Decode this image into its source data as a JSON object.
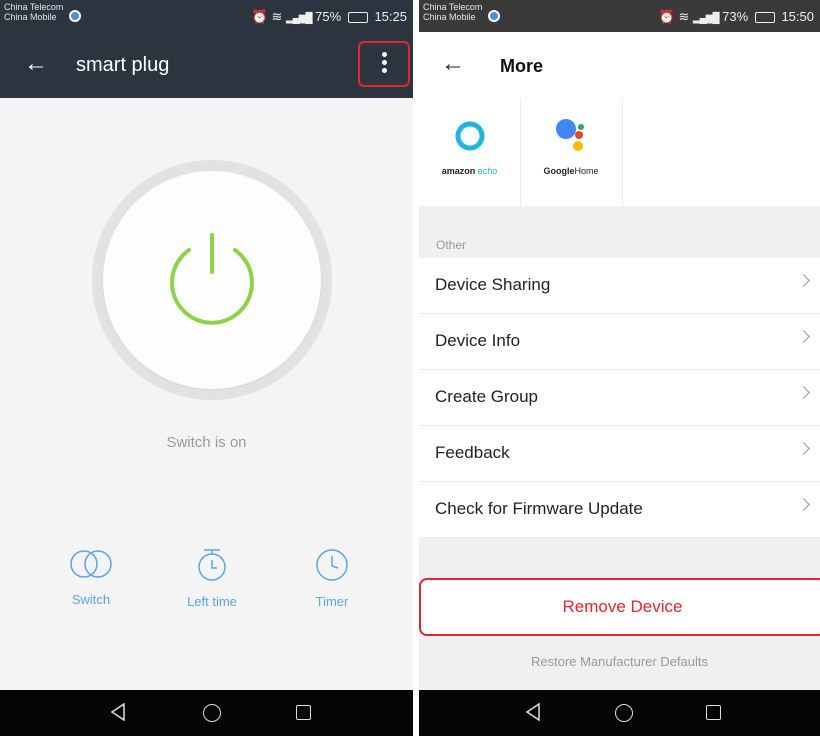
{
  "left": {
    "status": {
      "carrier1": "China Telecom",
      "carrier2": "China Mobile",
      "battery": "75%",
      "time": "15:25"
    },
    "appbar": {
      "title": "smart plug"
    },
    "switch_status": "Switch is on",
    "controls": [
      {
        "label": "Switch",
        "icon": "toggle-icon"
      },
      {
        "label": "Left time",
        "icon": "stopwatch-icon"
      },
      {
        "label": "Timer",
        "icon": "clock-icon"
      }
    ],
    "colors": {
      "header": "#2c3440",
      "power_green": "#8dd24a",
      "accent_blue": "#5aa5e8",
      "highlight_red": "#e0262e"
    }
  },
  "right": {
    "status": {
      "carrier1": "China Telecom",
      "carrier2": "China Mobile",
      "battery": "73%",
      "time": "15:50"
    },
    "appbar": {
      "title": "More"
    },
    "integrations": [
      {
        "name_bold": "amazon",
        "name_light": "echo",
        "icon": "amazon-echo-icon"
      },
      {
        "name_bold": "Google",
        "name_light": "Home",
        "icon": "google-home-icon"
      }
    ],
    "section_label": "Other",
    "menu": [
      {
        "label": "Device Sharing"
      },
      {
        "label": "Device Info"
      },
      {
        "label": "Create Group"
      },
      {
        "label": "Feedback"
      },
      {
        "label": "Check for Firmware Update"
      }
    ],
    "remove_label": "Remove Device",
    "restore_label": "Restore Manufacturer Defaults"
  }
}
